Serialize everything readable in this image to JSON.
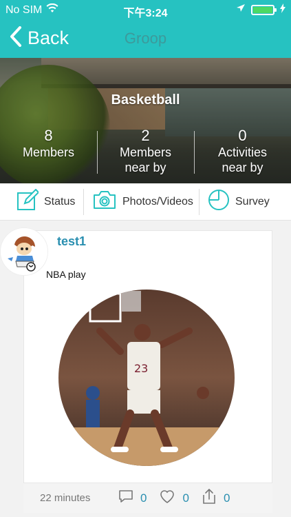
{
  "status_bar": {
    "carrier": "No SIM",
    "time": "下午3:24"
  },
  "nav": {
    "back_label": "Back",
    "title": "Groop"
  },
  "group": {
    "name": "Basketball",
    "stats": [
      {
        "value": "8",
        "label_line1": "Members",
        "label_line2": ""
      },
      {
        "value": "2",
        "label_line1": "Members",
        "label_line2": "near by"
      },
      {
        "value": "0",
        "label_line1": "Activities",
        "label_line2": "near by"
      }
    ]
  },
  "actions": [
    {
      "label": "Status",
      "icon": "edit-icon"
    },
    {
      "label": "Photos/Videos",
      "icon": "camera-icon"
    },
    {
      "label": "Survey",
      "icon": "pie-chart-icon"
    }
  ],
  "post": {
    "username": "test1",
    "text": "NBA play",
    "time_ago": "22 minutes",
    "comments": "0",
    "likes": "0",
    "shares": "0"
  },
  "colors": {
    "accent": "#26c2c1",
    "link": "#2a8fb0"
  }
}
